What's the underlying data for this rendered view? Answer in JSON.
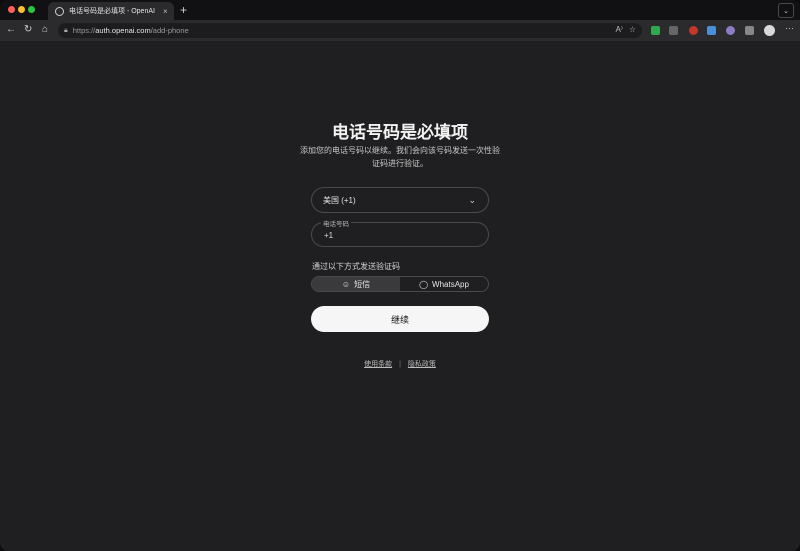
{
  "browser": {
    "tab_title": "电话号码是必填项 - OpenAI",
    "tab_close": "×",
    "new_tab": "+",
    "tab_menu": "⌄",
    "url_prefix": "https://",
    "url_domain": "auth.openai.com",
    "url_path": "/add-phone",
    "more": "···"
  },
  "page": {
    "title": "电话号码是必填项",
    "subtitle": "添加您的电话号码以继续。我们会向该号码发送一次性验证码进行验证。",
    "country_select": "美国 (+1)",
    "phone_label": "电话号码",
    "phone_value": "+1",
    "method_label": "通过以下方式发送验证码",
    "methods": [
      {
        "label": "短信",
        "icon": "chat-bubble-icon",
        "selected": true
      },
      {
        "label": "WhatsApp",
        "icon": "whatsapp-icon",
        "selected": false
      }
    ],
    "continue_label": "继续",
    "footer": {
      "terms": "使用条款",
      "divider": "|",
      "privacy": "隐私政策"
    }
  }
}
